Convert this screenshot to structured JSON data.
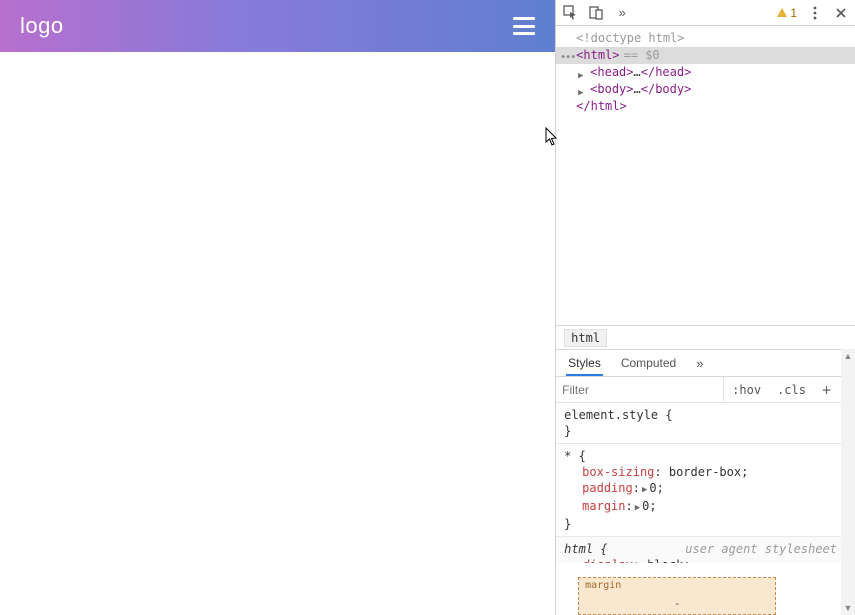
{
  "page": {
    "navbar": {
      "logo": "logo"
    }
  },
  "devtools": {
    "toolbar": {
      "warnings": "1"
    },
    "dom": {
      "doctype": "<!doctype html>",
      "html_open": "<html>",
      "eq0": "== $0",
      "head_open": "<head>",
      "head_close": "</head>",
      "body_open": "<body>",
      "body_close": "</body>",
      "html_close": "</html>",
      "ellipsis": "…"
    },
    "breadcrumb": {
      "current": "html"
    },
    "styles_tabs": {
      "styles": "Styles",
      "computed": "Computed"
    },
    "filter": {
      "placeholder": "Filter",
      "hov": ":hov",
      "cls": ".cls"
    },
    "rules": {
      "element_style": "element.style {",
      "close": "}",
      "star": "* {",
      "box_sizing_p": "box-sizing",
      "box_sizing_v": "border-box",
      "padding_p": "padding",
      "zero": "0",
      "margin_p": "margin",
      "html_sel": "html {",
      "ua": "user agent stylesheet",
      "display_p": "display",
      "display_v": "block"
    },
    "boxmodel": {
      "margin_label": "margin",
      "dash": "-"
    }
  }
}
